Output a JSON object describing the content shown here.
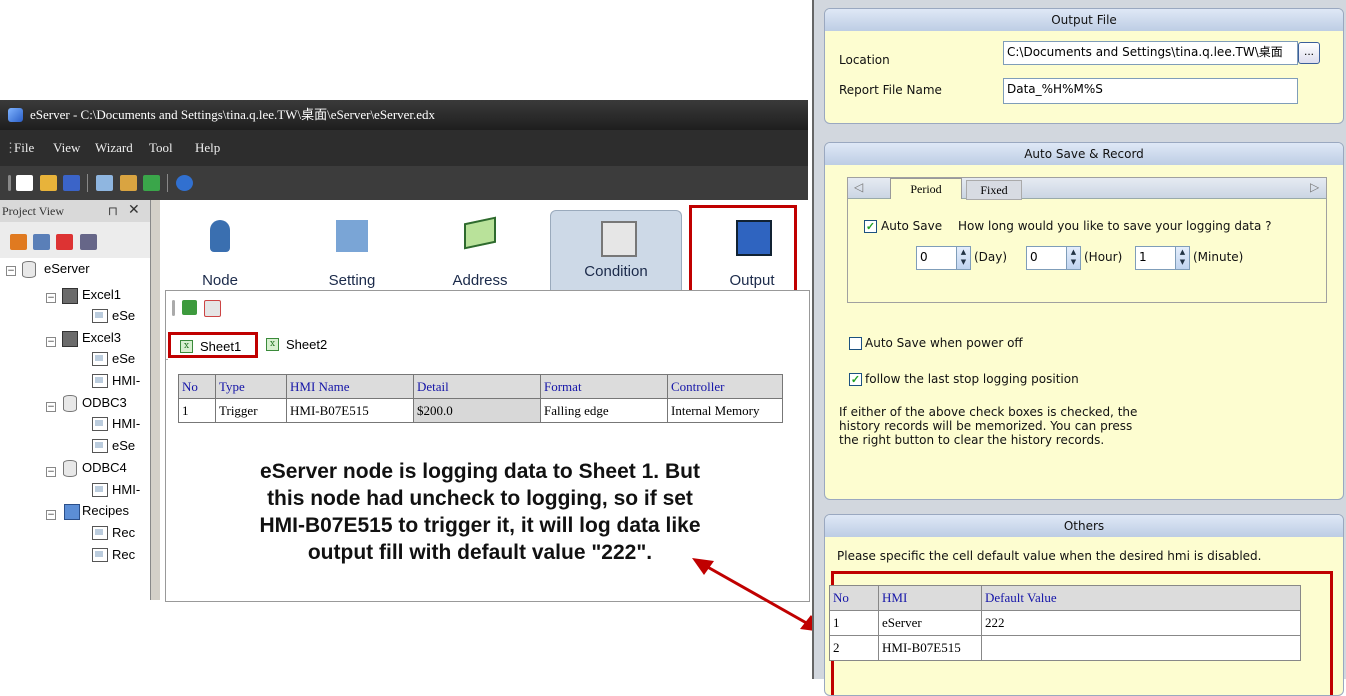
{
  "window": {
    "title": "eServer - C:\\Documents and Settings\\tina.q.lee.TW\\桌面\\eServer\\eServer.edx",
    "menu": [
      "File",
      "View",
      "Wizard",
      "Tool",
      "Help"
    ]
  },
  "project_view": {
    "title": "Project View",
    "tree": [
      {
        "label": "eServer"
      },
      {
        "label": "Excel1"
      },
      {
        "label": "eSe"
      },
      {
        "label": "Excel3"
      },
      {
        "label": "eSe"
      },
      {
        "label": "HMI-"
      },
      {
        "label": "ODBC3"
      },
      {
        "label": "HMI-"
      },
      {
        "label": "eSe"
      },
      {
        "label": "ODBC4"
      },
      {
        "label": "HMI-"
      },
      {
        "label": "Recipes"
      },
      {
        "label": "Rec"
      },
      {
        "label": "Rec"
      }
    ]
  },
  "tabs": [
    "Node",
    "Setting",
    "Address",
    "Condition",
    "Output"
  ],
  "sheets": [
    "Sheet1",
    "Sheet2"
  ],
  "grid": {
    "headers": [
      "No",
      "Type",
      "HMI Name",
      "Detail",
      "Format",
      "Controller"
    ],
    "rows": [
      [
        "1",
        "Trigger",
        "HMI-B07E515",
        "$200.0",
        "Falling edge",
        "Internal Memory"
      ]
    ]
  },
  "annotation": {
    "lines": [
      "eServer node is logging data to Sheet 1. But",
      "this node had uncheck to logging, so if set",
      "HMI-B07E515 to trigger it, it will log data like",
      "output fill with default value \"222\"."
    ]
  },
  "output_file": {
    "title": "Output File",
    "location_label": "Location",
    "location_value": "C:\\Documents and Settings\\tina.q.lee.TW\\桌面",
    "browse": "...",
    "report_label": "Report File Name",
    "report_value": "Data_%H%M%S"
  },
  "auto_save": {
    "title": "Auto Save & Record",
    "tabs": [
      "Period",
      "Fixed"
    ],
    "autosave_label": "Auto Save",
    "question": "How long would you like to save your logging data ?",
    "day_value": "0",
    "day_unit": "(Day)",
    "hour_value": "0",
    "hour_unit": "(Hour)",
    "minute_value": "1",
    "minute_unit": "(Minute)",
    "power_off_label": "Auto Save when power off",
    "follow_label": "follow the last stop logging position",
    "note_lines": [
      "If either of the above check boxes is checked, the",
      "history records will be memorized. You can press",
      "the right button to clear the history records."
    ]
  },
  "others": {
    "title": "Others",
    "desc": "Please specific the cell default  value when the desired hmi is disabled.",
    "headers": [
      "No",
      "HMI",
      "Default Value"
    ],
    "rows": [
      [
        "1",
        "eServer",
        "222"
      ],
      [
        "2",
        "HMI-B07E515",
        ""
      ]
    ]
  },
  "colors": {
    "highlight": "#c00000",
    "panel_bg": "#fdfdd0",
    "arrow": "#c00000"
  }
}
